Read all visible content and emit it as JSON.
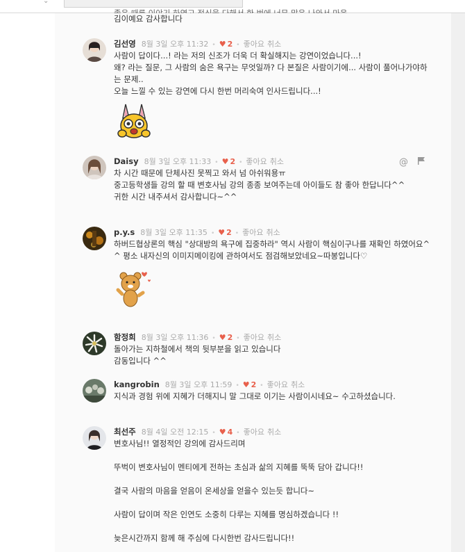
{
  "browser": {
    "search_placeholder": ""
  },
  "partial_comment": {
    "line_a": "좋은 때를 이야기 하였고 정신을 다해서 한 번에 너무 많은 나와서 마음",
    "line_b": "김이예요 감사합니다"
  },
  "comments": [
    {
      "author": "김선영",
      "date": "8월 3일 오후 11:32",
      "likes": "2",
      "like_label": "좋아요",
      "cancel_label": "취소",
      "text": "사람이 답이다...! 라는 저의 신조가 더욱 더 확실해지는 강연이었습니다...!\n왜? 라는 질문, 그 사람의 숨은 욕구는 무엇일까? 다 본질은 사람이기에... 사람이 풀어나가야하는 문제..\n오늘 느낄 수 있는 강연에 다시 한번 머리숙여 인사드립니다...!",
      "sticker": "rabbit-emoticon"
    },
    {
      "author": "Daisy",
      "date": "8월 3일 오후 11:33",
      "likes": "2",
      "like_label": "좋아요",
      "cancel_label": "취소",
      "text": "차 시간 때문에 단체사진 못찍고 와서 넘 아쉬워용ㅠ\n중고등학생들 강의 할 때 변호사님 강의 종종 보여주는데 아이들도 참 좋아 한답니다^^\n귀한 시간 내주셔서 감사합니다~^^",
      "mention_icon": "@",
      "flag_icon": "flag"
    },
    {
      "author": "p.y.s",
      "date": "8월 3일 오후 11:35",
      "likes": "2",
      "like_label": "좋아요",
      "cancel_label": "취소",
      "text": "하버드협상론의 핵심 \"상대방의 욕구에 집중하라\" 역시 사람이 핵심이구나를 재확인 하였어요^^ 평소 내자신의 이미지메이킹에 관하여서도 점검해보았네요~따봉입니다♡",
      "sticker": "ryan-emoticon"
    },
    {
      "author": "함정희",
      "date": "8월 3일 오후 11:36",
      "likes": "2",
      "like_label": "좋아요",
      "cancel_label": "취소",
      "text": "돌아가는 지하철에서 책의 뒷부분을 읽고 있습니다\n감동입니다 ^^"
    },
    {
      "author": "kangrobin",
      "date": "8월 3일 오후 11:59",
      "likes": "2",
      "like_label": "좋아요",
      "cancel_label": "취소",
      "text": "지식과 경험 위에 지혜가 더해지니 말 그대로 이기는 사람이시네요~ 수고하셨습니다."
    },
    {
      "author": "최선주",
      "date": "8월 4일 오전 12:15",
      "likes": "4",
      "like_label": "좋아요",
      "cancel_label": "취소",
      "text": "변호사님!! 열정적인 강의에 감사드리며\n\n뚜벅이 변호사님이 멘티에게 전하는 초심과 삶의 지혜를 뚝뚝 담아 갑니다!!\n\n결국 사람의 마음을 얻음이 온세상을 얻을수 있는듯 합니다~\n\n사람이 답이며 작은 인연도 소중히 다루는 지혜를 명심하겠습니다 !!\n\n늦은시간까지 함께 해 주심에 다시한번 감사드립니다!!"
    }
  ],
  "colors": {
    "heart": "#e8604c",
    "meta": "#aaaaaa",
    "text": "#333333",
    "panel": "#fafafa"
  }
}
